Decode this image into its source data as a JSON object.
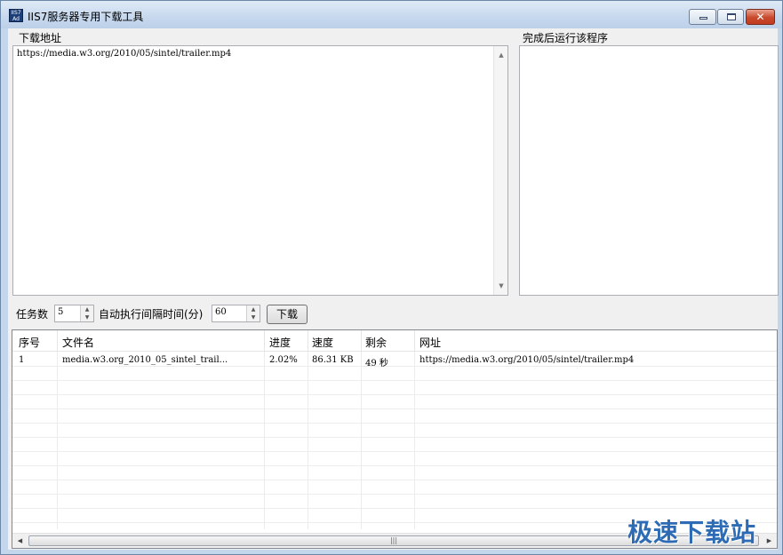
{
  "window": {
    "icon_text": "IIS7 Ad",
    "title": "IIS7服务器专用下载工具",
    "min_glyph": "",
    "max_glyph": "",
    "close_glyph": "✕"
  },
  "download_group": {
    "label": "下载地址",
    "content": "https://media.w3.org/2010/05/sintel/trailer.mp4",
    "scroll_up": "▲",
    "scroll_down": "▼"
  },
  "run_group": {
    "label": "完成后运行该程序"
  },
  "controls": {
    "tasks_label": "任务数",
    "tasks_value": "5",
    "interval_label": "自动执行间隔时间(分)",
    "interval_value": "60",
    "spin_up": "▲",
    "spin_down": "▼",
    "download_button": "下载"
  },
  "table": {
    "columns": [
      "序号",
      "文件名",
      "进度",
      "速度",
      "剩余",
      "网址"
    ],
    "rows": [
      {
        "index": "1",
        "filename": "media.w3.org_2010_05_sintel_trail...",
        "progress": "2.02%",
        "speed": "86.31 KB",
        "remaining": "49 秒",
        "url": "https://media.w3.org/2010/05/sintel/trailer.mp4"
      }
    ],
    "scroll_left": "◀",
    "scroll_right": "▶",
    "scroll_thumb": "|||"
  },
  "watermark": "极速下载站"
}
